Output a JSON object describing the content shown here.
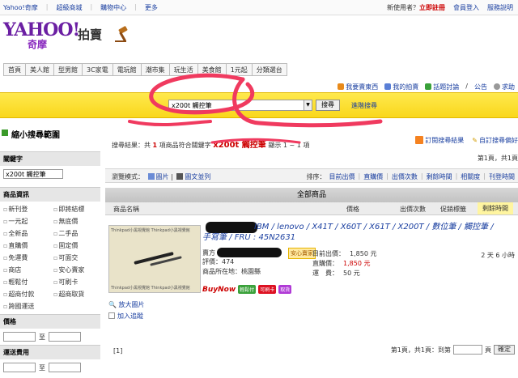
{
  "topbar": {
    "left": [
      "Yahoo!奇摩",
      "超級商城",
      "購物中心",
      "更多"
    ],
    "new_user": "新使用者？",
    "signup": "立即註冊",
    "login": "會員登入",
    "service": "服務說明"
  },
  "logo": {
    "brand": "YAHOO!",
    "sub": "奇摩",
    "section": "拍賣"
  },
  "categories": [
    "首頁",
    "美人館",
    "型男館",
    "3C家電",
    "電玩館",
    "潮市集",
    "玩生活",
    "美食館",
    "1元起",
    "分類選台"
  ],
  "userrow": {
    "sell": "我要賣東西",
    "mine": "我的拍賣",
    "forum": "話題討論",
    "notice": "公告",
    "help": "求助"
  },
  "search": {
    "value": "x200t 觸控筆",
    "button": "搜尋",
    "advanced": "進階搜尋"
  },
  "sidebar": {
    "title": "縮小搜尋範圍",
    "keyword_head": "關鍵字",
    "keyword_value": "x200t 觸控筆",
    "info_head": "商品資訊",
    "options": [
      "新刊登",
      "即將結標",
      "一元起",
      "無底價",
      "全新品",
      "二手品",
      "直購價",
      "固定價",
      "免運費",
      "可面交",
      "商店",
      "安心賣家",
      "輕鬆付",
      "可刷卡",
      "超商付款",
      "超商取貨",
      "跨國運送"
    ],
    "price_head": "價格",
    "price_to": "至",
    "ship_head": "運送費用",
    "ship_to": "至"
  },
  "results": {
    "prefix": "搜尋結果：共",
    "count": "1",
    "mid": "項商品符合關鍵字",
    "keyword": "x200t 觸控筆",
    "suffix": "顯示 1 ~ 1 項",
    "subscribe": "訂閱搜尋結果",
    "prefs": "自訂搜尋偏好",
    "pager_top": "第1頁，共1頁"
  },
  "modebar": {
    "label": "瀏覽模式：",
    "image": "圖片",
    "list": "圖文並列",
    "sort_label": "排序：",
    "sorts": [
      "目前出價",
      "直購價",
      "出價次數",
      "剩餘時間",
      "相關度",
      "刊登時間"
    ]
  },
  "all_goods": "全部商品",
  "columns": {
    "name": "商品名稱",
    "price": "價格",
    "bids": "出價次數",
    "promo": "促銷標籤",
    "remaining": "剩餘時間"
  },
  "item": {
    "title": "IBM / lenovo / X41T / X60T / X61T / X200T / 數位筆 / 觸控筆 / 手寫筆 / FRU : 45N2631",
    "thumb_caption": "Thinkpad小黑視覺館 Thinkpad小黑視覺館",
    "seller_label": "賣方",
    "seller_badge": "安心賣家",
    "rating": "評價：474",
    "location": "商品所在地：桃園縣",
    "current_label": "目前出價：",
    "current": "1,850 元",
    "direct_label": "直購價：",
    "direct": "1,850 元",
    "ship_label": "運　費：",
    "ship": "50 元",
    "remaining": "2 天 6 小時",
    "buynow": "BuyNow",
    "badges": [
      "輕鬆付",
      "可刷卡",
      "取貨"
    ],
    "enlarge": "放大圖片",
    "track": "加入追蹤"
  },
  "bottom": {
    "page_num": "[1]",
    "pager": "第1頁，共1頁：到第",
    "page_unit": "頁",
    "ok": "確定"
  }
}
